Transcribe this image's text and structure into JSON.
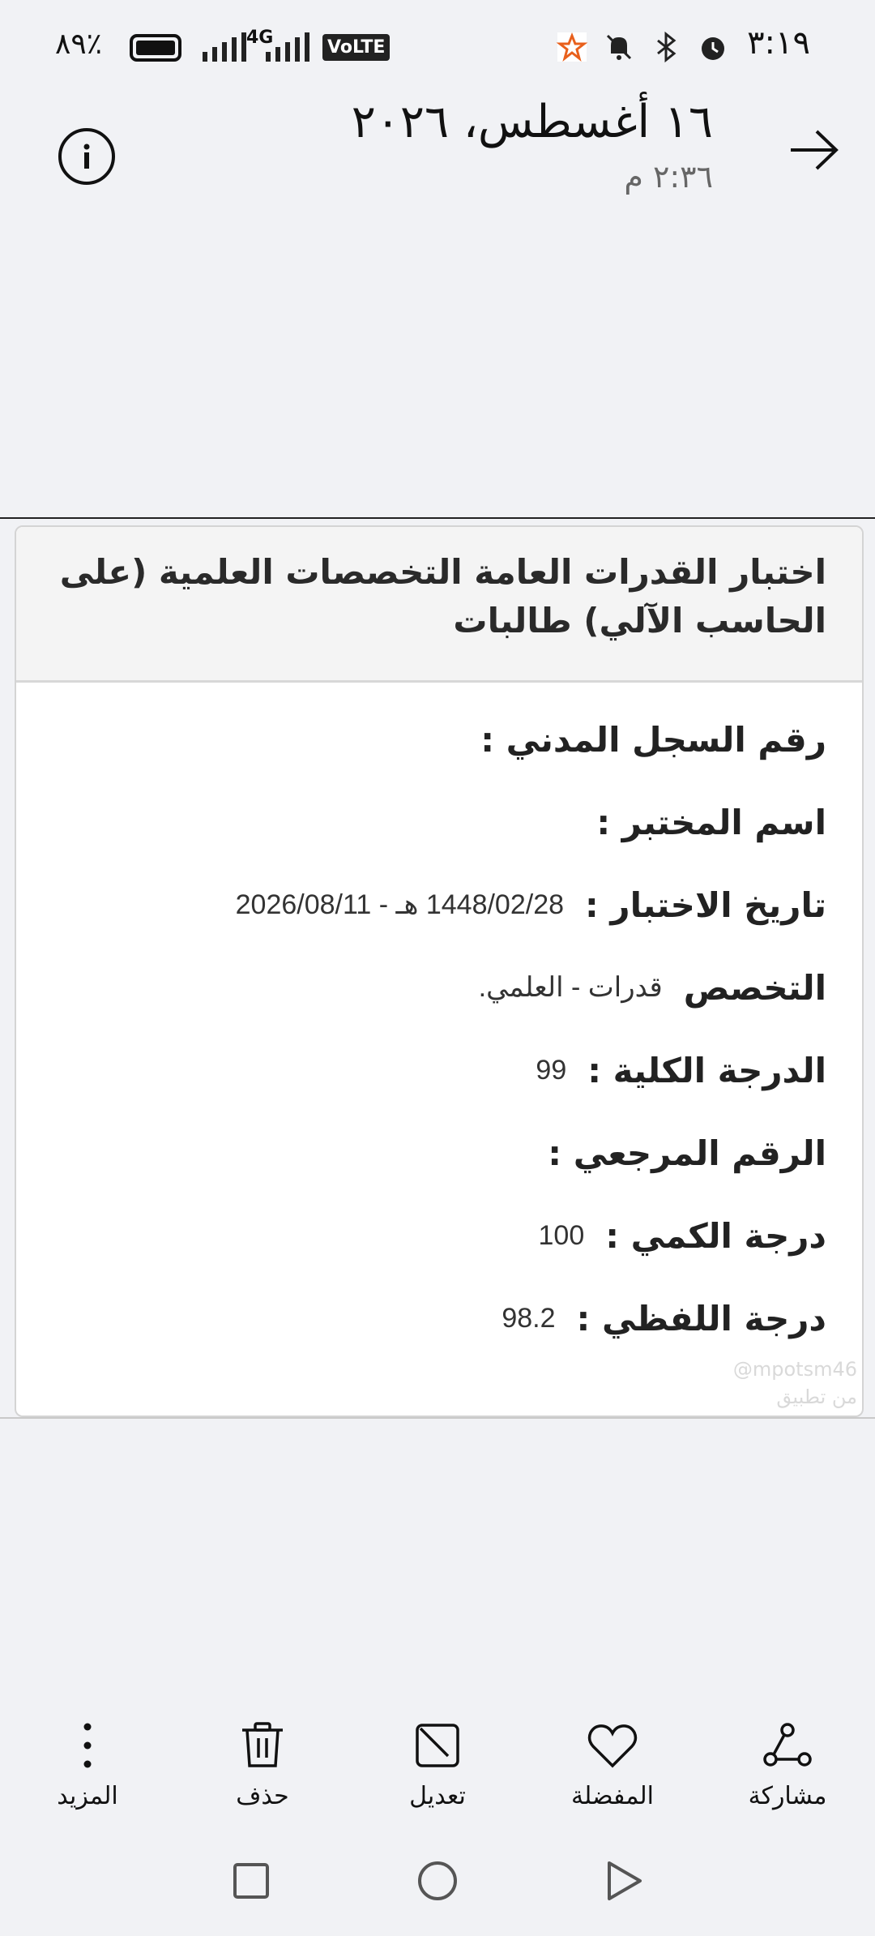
{
  "status_bar": {
    "time": "٣:١٩",
    "battery_percent": "٪٨٩",
    "network": "4G",
    "volte": "VoLTE",
    "icons": [
      "alarm-icon",
      "bluetooth-icon",
      "mute-bell-icon",
      "app-star-icon"
    ]
  },
  "header": {
    "title": "١٦ أغسطس، ٢٠٢٦",
    "subtitle": "٢:٣٦ م"
  },
  "document": {
    "title": "اختبار القدرات العامة التخصصات العلمية (على الحاسب الآلي) طالبات",
    "rows": [
      {
        "label": "رقم السجل المدني :",
        "value": ""
      },
      {
        "label": "اسم المختبر :",
        "value": ""
      },
      {
        "label": "تاريخ الاختبار :",
        "value": "1448/02/28 هـ - 2026/08/11"
      },
      {
        "label": "التخصص",
        "value": "قدرات - العلمي."
      },
      {
        "label": "الدرجة الكلية :",
        "value": "99"
      },
      {
        "label": "الرقم المرجعي :",
        "value": ""
      },
      {
        "label": "درجة الكمي :",
        "value": "100"
      },
      {
        "label": "درجة اللفظي :",
        "value": "98.2"
      }
    ],
    "watermark_line1": "@mpotsm46",
    "watermark_line2": "من تطبيق"
  },
  "actions": {
    "share": "مشاركة",
    "favorite": "المفضلة",
    "edit": "تعديل",
    "delete": "حذف",
    "more": "المزيد"
  },
  "colors": {
    "background": "#f1f2f5",
    "card_header": "#f4f4f4",
    "text": "#111111"
  }
}
